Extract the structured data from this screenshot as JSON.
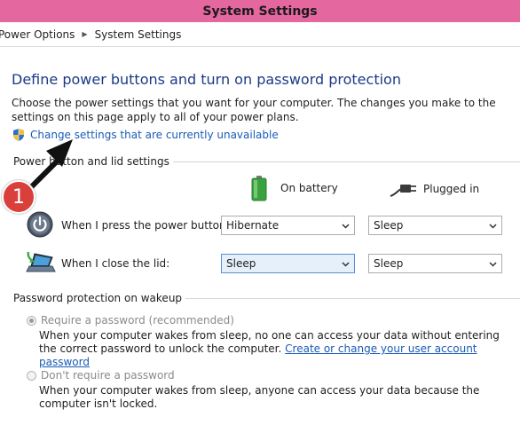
{
  "window": {
    "title": "System Settings"
  },
  "breadcrumb": {
    "items": [
      "Power Options",
      "System Settings"
    ]
  },
  "page": {
    "heading": "Define power buttons and turn on password protection",
    "description": "Choose the power settings that you want for your computer. The changes you make to the settings on this page apply to all of your power plans.",
    "change_link": "Change settings that are currently unavailable"
  },
  "power_section": {
    "label": "Power button and lid settings",
    "columns": {
      "battery": "On battery",
      "plugged": "Plugged in"
    },
    "rows": [
      {
        "label": "When I press the power button:",
        "battery": "Hibernate",
        "plugged": "Sleep"
      },
      {
        "label": "When I close the lid:",
        "battery": "Sleep",
        "plugged": "Sleep"
      }
    ]
  },
  "password_section": {
    "label": "Password protection on wakeup",
    "require": {
      "label": "Require a password (recommended)",
      "desc_text": "When your computer wakes from sleep, no one can access your data without entering the correct password to unlock the computer.",
      "desc_link": "Create or change your user account password",
      "selected": true
    },
    "dont_require": {
      "label": "Don't require a password",
      "desc_text": "When your computer wakes from sleep, anyone can access your data because the computer isn't locked.",
      "selected": false
    }
  },
  "annotation": {
    "badge_number": "1"
  },
  "colors": {
    "titlebar": "#e567a0",
    "link": "#1a5bb5",
    "heading": "#1a3a86",
    "badge": "#d9403b"
  }
}
